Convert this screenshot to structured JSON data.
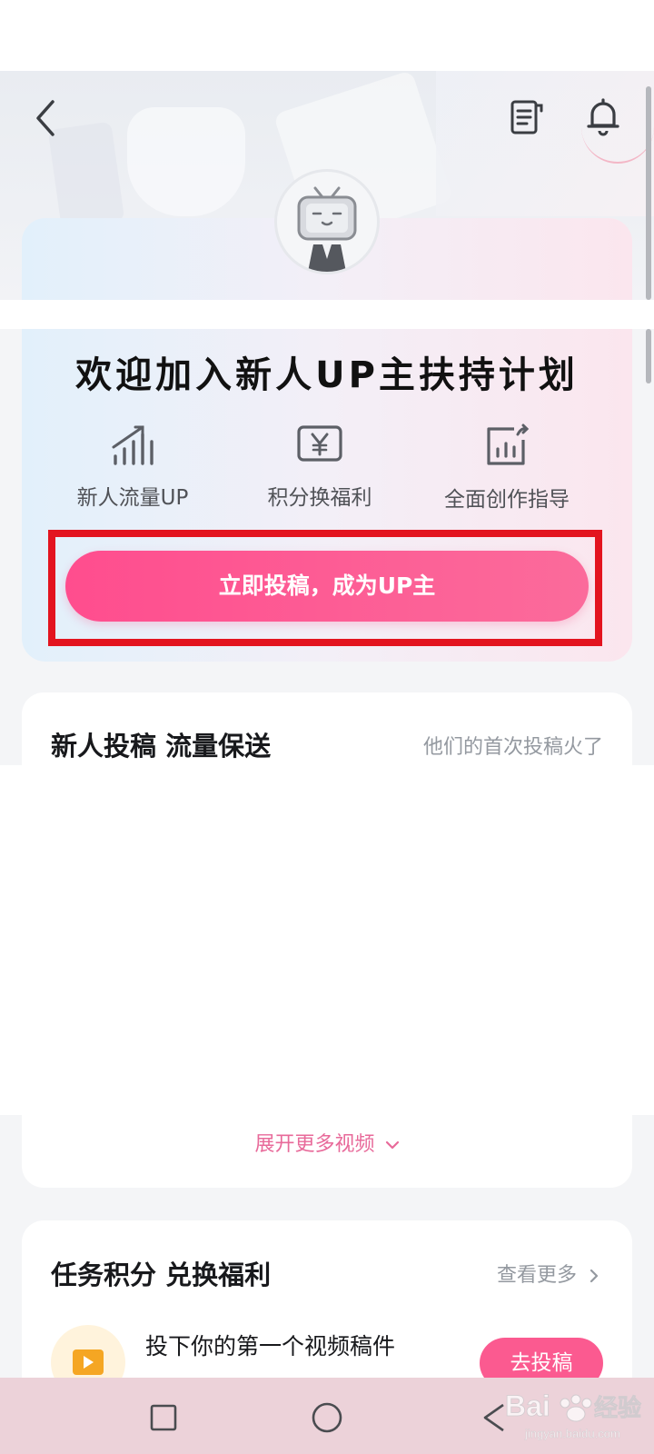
{
  "welcome": {
    "title": "欢迎加入新人UP主扶持计划",
    "features": [
      {
        "label": "新人流量UP",
        "icon": "signal-bars-icon"
      },
      {
        "label": "积分换福利",
        "icon": "yen-card-icon"
      },
      {
        "label": "全面创作指导",
        "icon": "chart-growth-icon"
      }
    ],
    "cta_label": "立即投稿，成为UP主"
  },
  "newbie": {
    "title": "新人投稿 流量保送",
    "subtitle": "他们的首次投稿火了",
    "expand_label": "展开更多视频"
  },
  "tasks": {
    "title": "任务积分 兑换福利",
    "more_label": "查看更多",
    "items": [
      {
        "name": "投下你的第一个视频稿件",
        "button": "去投稿"
      }
    ]
  },
  "watermark": {
    "text": "Baidu经验",
    "url": "jingyan.baidu.com"
  },
  "colors": {
    "accent_pink": "#fb5a90",
    "highlight_red": "#e3141f",
    "card_gradient_left": "#e2f0fb",
    "card_gradient_right": "#fbe6ee"
  }
}
